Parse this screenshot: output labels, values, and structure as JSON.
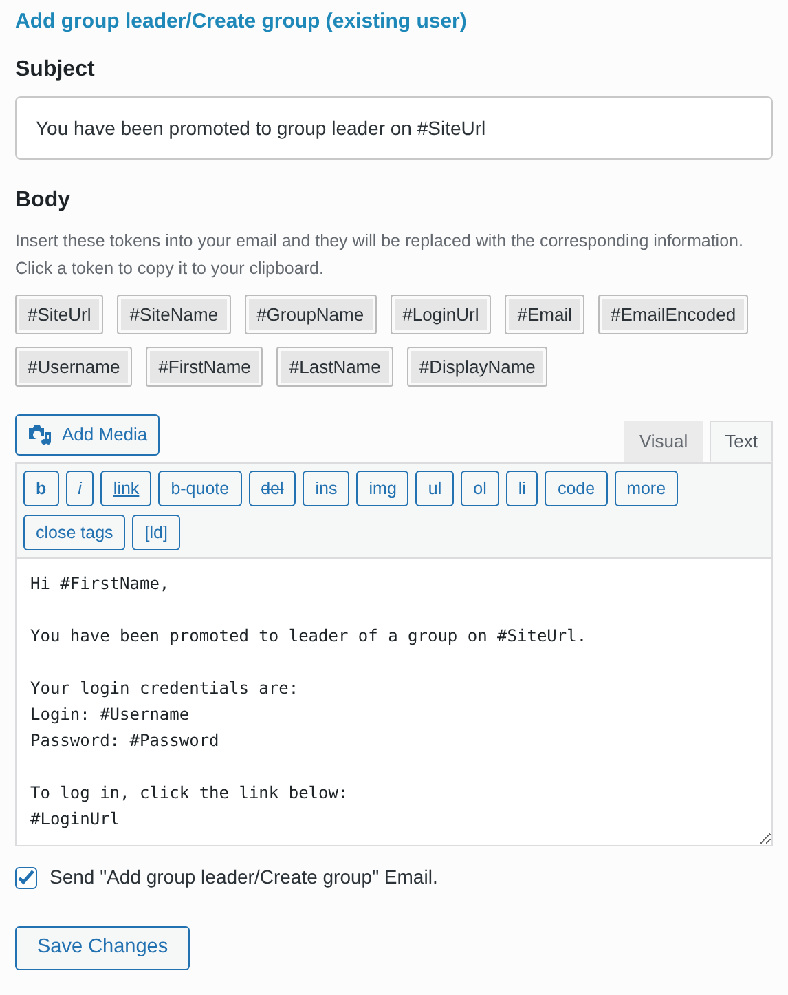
{
  "heading": "Add group leader/Create group (existing user)",
  "subject": {
    "label": "Subject",
    "value": "You have been promoted to group leader on #SiteUrl"
  },
  "body": {
    "label": "Body",
    "description": "Insert these tokens into your email and they will be replaced with the corresponding information. Click a token to copy it to your clipboard.",
    "tokens": [
      "#SiteUrl",
      "#SiteName",
      "#GroupName",
      "#LoginUrl",
      "#Email",
      "#EmailEncoded",
      "#Username",
      "#FirstName",
      "#LastName",
      "#DisplayName"
    ],
    "add_media": "Add Media",
    "tabs": [
      {
        "label": "Visual",
        "selected": false
      },
      {
        "label": "Text",
        "selected": true
      }
    ],
    "quicktags": [
      {
        "label": "b",
        "kind": "bold"
      },
      {
        "label": "i",
        "kind": "italic"
      },
      {
        "label": "link",
        "kind": "link"
      },
      {
        "label": "b-quote",
        "kind": "plain"
      },
      {
        "label": "del",
        "kind": "strike"
      },
      {
        "label": "ins",
        "kind": "plain"
      },
      {
        "label": "img",
        "kind": "plain"
      },
      {
        "label": "ul",
        "kind": "plain"
      },
      {
        "label": "ol",
        "kind": "plain"
      },
      {
        "label": "li",
        "kind": "plain"
      },
      {
        "label": "code",
        "kind": "plain"
      },
      {
        "label": "more",
        "kind": "plain"
      },
      {
        "label": "close tags",
        "kind": "plain"
      },
      {
        "label": "[ld]",
        "kind": "plain"
      }
    ],
    "content": "Hi #FirstName,\n\nYou have been promoted to leader of a group on #SiteUrl.\n\nYour login credentials are:\nLogin: #Username\nPassword: #Password\n\nTo log in, click the link below:\n#LoginUrl"
  },
  "send_email": {
    "label": "Send \"Add group leader/Create group\" Email.",
    "checked": true
  },
  "save_button": "Save Changes"
}
